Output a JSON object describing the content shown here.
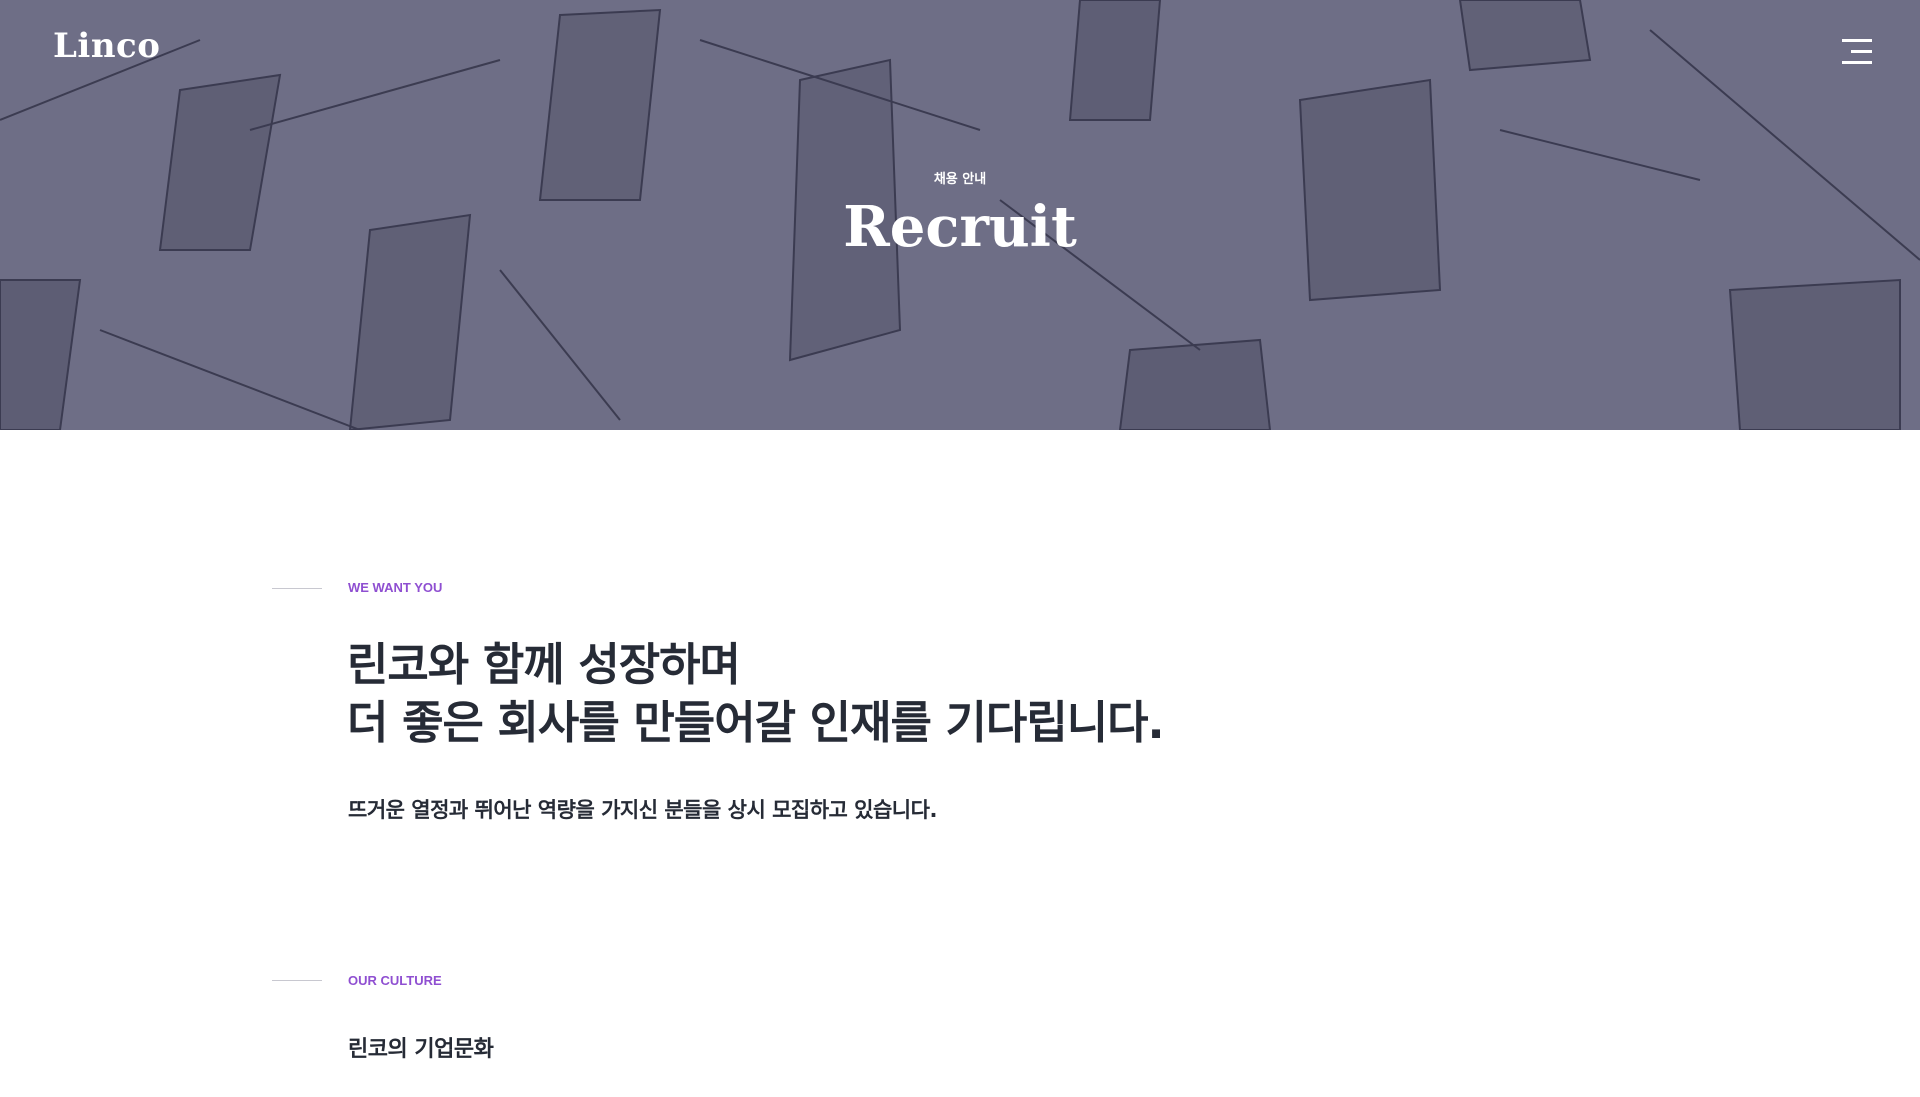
{
  "header": {
    "logo": "Linco",
    "menu_icon": "hamburger-icon"
  },
  "hero": {
    "subtitle": "채용 안내",
    "title": "Recruit"
  },
  "want": {
    "eyebrow": "WE WANT YOU",
    "headline_1": "린코와 함께 성장하며",
    "headline_2": "더 좋은 회사를 만들어갈 인재를 기다립니다.",
    "lead": "뜨거운 열정과 뛰어난 역량을 가지신 분들을 상시 모집하고 있습니다."
  },
  "culture": {
    "eyebrow": "OUR CULTURE",
    "title": "린코의 기업문화"
  },
  "colors": {
    "accent": "#8f4fd1",
    "text": "#262b36",
    "hero_bg": "#6e6e86"
  }
}
